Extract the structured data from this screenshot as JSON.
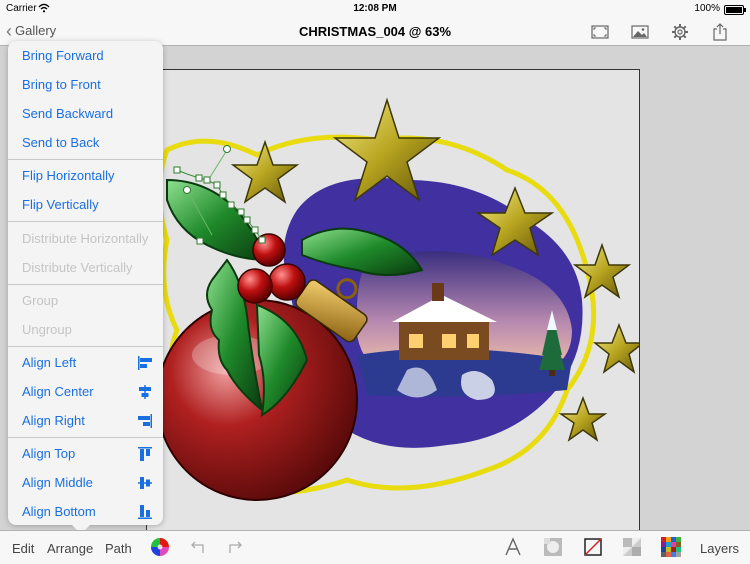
{
  "status_bar": {
    "carrier": "Carrier",
    "time": "12:08 PM",
    "battery_percent": "100%",
    "battery_level": 1.0
  },
  "nav": {
    "back_label": "Gallery",
    "title": "CHRISTMAS_004 @ 63%",
    "icons": [
      "fullscreen-icon",
      "image-icon",
      "settings-gear-icon",
      "share-icon"
    ]
  },
  "arrange_menu": {
    "items": [
      {
        "label": "Bring Forward",
        "enabled": true
      },
      {
        "label": "Bring to Front",
        "enabled": true
      },
      {
        "label": "Send Backward",
        "enabled": true
      },
      {
        "label": "Send to Back",
        "enabled": true
      },
      {
        "label": "Flip Horizontally",
        "enabled": true
      },
      {
        "label": "Flip Vertically",
        "enabled": true
      },
      {
        "label": "Distribute Horizontally",
        "enabled": false
      },
      {
        "label": "Distribute Vertically",
        "enabled": false
      },
      {
        "label": "Group",
        "enabled": false
      },
      {
        "label": "Ungroup",
        "enabled": false
      },
      {
        "label": "Align Left",
        "enabled": true,
        "icon": "align-left-icon"
      },
      {
        "label": "Align Center",
        "enabled": true,
        "icon": "align-center-icon"
      },
      {
        "label": "Align Right",
        "enabled": true,
        "icon": "align-right-icon"
      },
      {
        "label": "Align Top",
        "enabled": true,
        "icon": "align-top-icon"
      },
      {
        "label": "Align Middle",
        "enabled": true,
        "icon": "align-middle-icon"
      },
      {
        "label": "Align Bottom",
        "enabled": true,
        "icon": "align-bottom-icon"
      }
    ]
  },
  "toolbar": {
    "edit": "Edit",
    "arrange": "Arrange",
    "path": "Path",
    "layers": "Layers",
    "icons": [
      "color-wheel-icon",
      "undo-icon",
      "redo-icon",
      "text-tool-icon",
      "mask-icon",
      "crop-icon",
      "transparency-icon",
      "swatches-icon"
    ]
  },
  "colors": {
    "accent": "#1a6fe0",
    "disabled": "#c4c4c4",
    "canvas_bg": "#d3d3d3"
  }
}
